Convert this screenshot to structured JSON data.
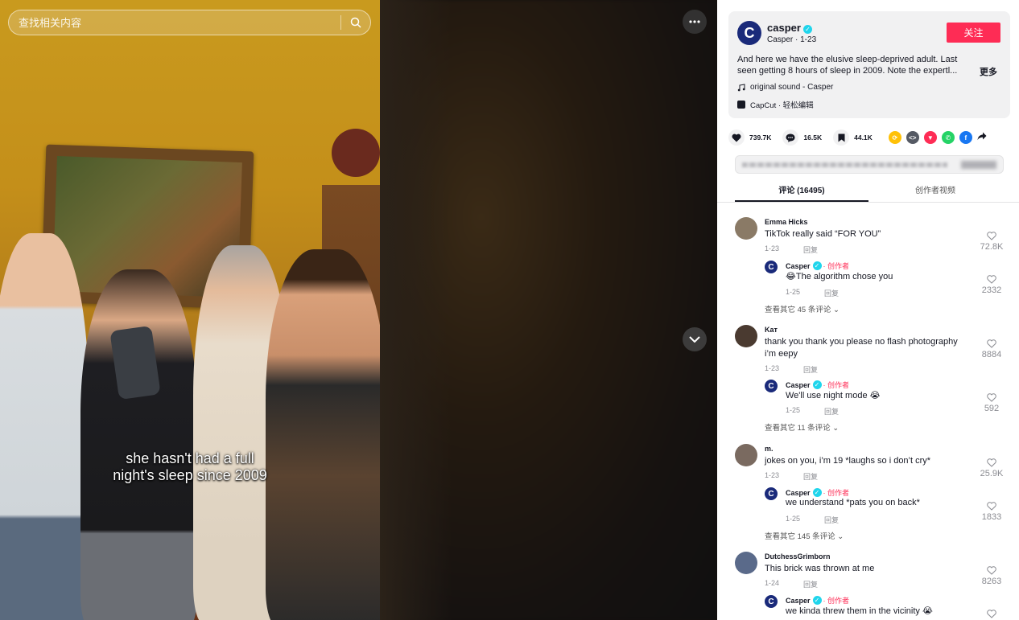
{
  "search": {
    "placeholder": "查找相关内容"
  },
  "video": {
    "caption_line1": "she hasn't had a full",
    "caption_line2": "night's sleep since 2009"
  },
  "author": {
    "avatar_letter": "C",
    "display_name": "casper",
    "subline": "Casper · 1-23",
    "follow_label": "关注",
    "description": "And here we have the elusive sleep-deprived adult. Last seen getting 8 hours of sleep in 2009. Note the expertl...",
    "more_label": "更多",
    "sound": "original sound - Casper",
    "capcut": "CapCut · 轻松编辑"
  },
  "stats": {
    "likes": "739.7K",
    "comments": "16.5K",
    "saves": "44.1K"
  },
  "share_icons": [
    {
      "name": "repost-icon",
      "color": "#ffc107"
    },
    {
      "name": "embed-icon",
      "color": "#555a64"
    },
    {
      "name": "send-icon",
      "color": "#fe2c55"
    },
    {
      "name": "whatsapp-icon",
      "color": "#25d366"
    },
    {
      "name": "facebook-icon",
      "color": "#1877f2"
    }
  ],
  "tabs": {
    "comments": "评论 (16495)",
    "creator_videos": "创作者视频"
  },
  "comments": [
    {
      "name": "Emma Hicks",
      "text": "TikTok really said “FOR YOU”",
      "date": "1-23",
      "reply_label": "回复",
      "likes": "72.8K",
      "avatar_color": "#8a7a66",
      "reply": {
        "name": "Casper",
        "creator": "· 创作者",
        "text": "😂The algorithm chose you",
        "date": "1-25",
        "reply_label": "回复",
        "likes": "2332"
      },
      "view_more": "查看其它 45 条评论"
    },
    {
      "name": "Kат",
      "text": "thank you thank you please no flash photography i’m eepy",
      "date": "1-23",
      "reply_label": "回复",
      "likes": "8884",
      "avatar_color": "#4a3a30",
      "reply": {
        "name": "Casper",
        "creator": "· 创作者",
        "text": "We'll use night mode 😭",
        "date": "1-25",
        "reply_label": "回复",
        "likes": "592"
      },
      "view_more": "查看其它 11 条评论"
    },
    {
      "name": "m.",
      "text": "jokes on you, i’m 19 *laughs so i don’t cry*",
      "date": "1-23",
      "reply_label": "回复",
      "likes": "25.9K",
      "avatar_color": "#7a6a60",
      "reply": {
        "name": "Casper",
        "creator": "· 创作者",
        "text": "we understand *pats you on back*",
        "date": "1-25",
        "reply_label": "回复",
        "likes": "1833"
      },
      "view_more": "查看其它 145 条评论"
    },
    {
      "name": "DutchessGrimborn",
      "text": "This brick was thrown at me",
      "date": "1-24",
      "reply_label": "回复",
      "likes": "8263",
      "avatar_color": "#5a6a8a",
      "reply": {
        "name": "Casper",
        "creator": "· 创作者",
        "text": "we kinda threw them in the vicinity 😭",
        "date": "",
        "reply_label": "",
        "likes": ""
      },
      "view_more": ""
    }
  ]
}
